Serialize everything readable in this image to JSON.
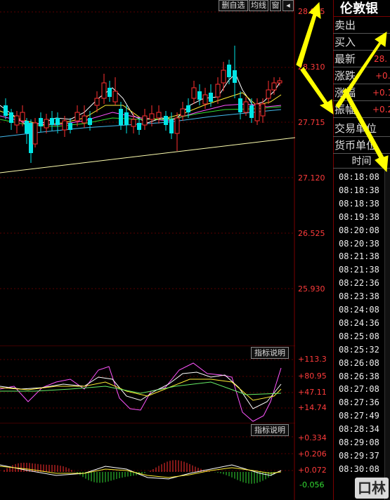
{
  "toolbar": {
    "btn1": "删自选",
    "btn2": "均线",
    "btn3": "窗",
    "btn4": "◂"
  },
  "price_axis": [
    "28.905",
    "28.310",
    "27.715",
    "27.120",
    "26.525",
    "25.930"
  ],
  "indicator1": {
    "button": "指标说明",
    "axis": [
      "+113.3",
      "+80.95",
      "+47.11",
      "+14.74"
    ]
  },
  "indicator2": {
    "button": "指标说明",
    "axis": [
      "+0.334",
      "+0.206",
      "+0.072",
      "-0.056"
    ]
  },
  "info_panel": {
    "title": "伦敦银",
    "rows": [
      {
        "label": "卖出",
        "value": ""
      },
      {
        "label": "买入",
        "value": ""
      },
      {
        "label": "最新",
        "value": "28."
      },
      {
        "label": "涨跌",
        "value": "+0."
      },
      {
        "label": "涨幅",
        "value": "+0.1"
      },
      {
        "label": "振幅",
        "value": "+0.2"
      },
      {
        "label": "交易单位",
        "value": ""
      },
      {
        "label": "货币单位",
        "value": ""
      }
    ],
    "time_header": "时间",
    "times": [
      "08:18:08",
      "08:18:38",
      "08:18:38",
      "08:19:38",
      "08:20:08",
      "08:20:38",
      "08:21:38",
      "08:21:38",
      "08:22:36",
      "08:23:38",
      "08:24:08",
      "08:24:36",
      "08:25:08",
      "08:25:32",
      "08:26:08",
      "08:26:38",
      "08:27:08",
      "08:27:36",
      "08:27:49",
      "08:28:34",
      "08:29:08",
      "08:29:37",
      "08:30:08"
    ]
  },
  "colors": {
    "up": "#ff3030",
    "down": "#00e5e5",
    "grid": "#7a0000",
    "arrow": "#ffff00"
  }
}
